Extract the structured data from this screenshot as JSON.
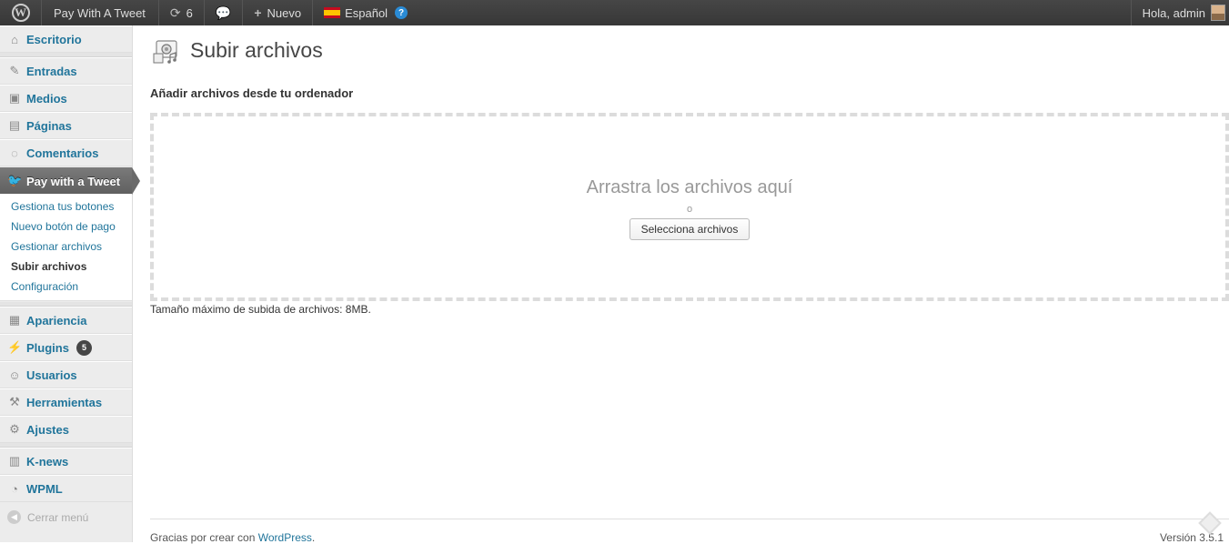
{
  "adminbar": {
    "site_name": "Pay With A Tweet",
    "updates_count": "6",
    "new_label": "Nuevo",
    "language": "Español",
    "greeting": "Hola, admin"
  },
  "sidebar": {
    "items": [
      {
        "label": "Escritorio",
        "icon": "home-icon"
      },
      {
        "label": "Entradas",
        "icon": "pin-icon"
      },
      {
        "label": "Medios",
        "icon": "media-icon"
      },
      {
        "label": "Páginas",
        "icon": "pages-icon"
      },
      {
        "label": "Comentarios",
        "icon": "comment-icon"
      },
      {
        "label": "Pay with a Tweet",
        "icon": "twitter-bird-icon"
      },
      {
        "label": "Apariencia",
        "icon": "appearance-icon"
      },
      {
        "label": "Plugins",
        "icon": "plugin-icon",
        "badge": "5"
      },
      {
        "label": "Usuarios",
        "icon": "users-icon"
      },
      {
        "label": "Herramientas",
        "icon": "tools-icon"
      },
      {
        "label": "Ajustes",
        "icon": "settings-icon"
      },
      {
        "label": "K-news",
        "icon": "news-icon"
      },
      {
        "label": "WPML",
        "icon": "wpml-icon"
      }
    ],
    "submenu": [
      "Gestiona tus botones",
      "Nuevo botón de pago",
      "Gestionar archivos",
      "Subir archivos",
      "Configuración"
    ],
    "collapse_label": "Cerrar menú"
  },
  "main": {
    "title": "Subir archivos",
    "section_heading": "Añadir archivos desde tu ordenador",
    "drop_text": "Arrastra los archivos aquí",
    "drop_or": "o",
    "select_button": "Selecciona archivos",
    "max_size": "Tamaño máximo de subida de archivos: 8MB."
  },
  "footer": {
    "thanks_prefix": "Gracias por crear con",
    "wordpress_link": "WordPress",
    "thanks_suffix": ".",
    "version": "Versión 3.5.1"
  },
  "colors": {
    "link": "#21759b",
    "adminbar_bg": "#464646",
    "active_menu": "#6a6a6a"
  }
}
